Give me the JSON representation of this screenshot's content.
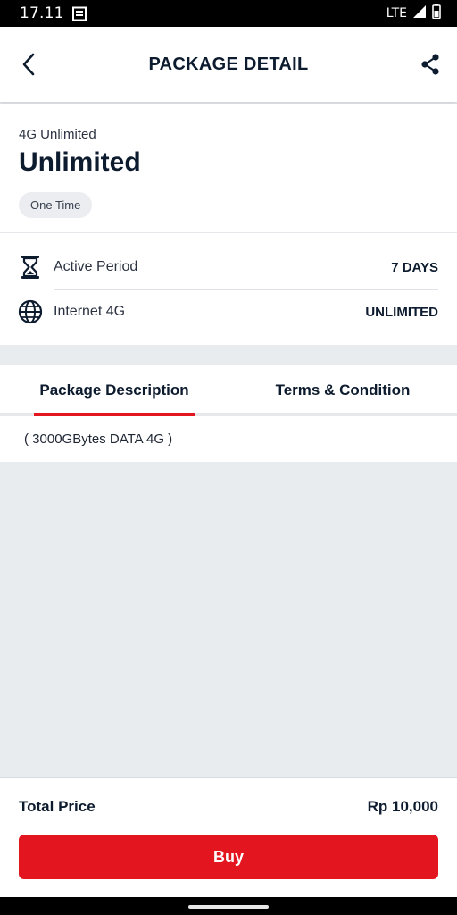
{
  "status_bar": {
    "time": "17.11",
    "network": "LTE",
    "icons": [
      "news-notification-icon",
      "signal-icon",
      "battery-icon"
    ]
  },
  "app_bar": {
    "title": "PACKAGE DETAIL",
    "back_icon": "back-arrow-icon",
    "share_icon": "share-icon"
  },
  "package": {
    "category": "4G Unlimited",
    "name": "Unlimited",
    "badge": "One Time"
  },
  "details": [
    {
      "icon": "hourglass-icon",
      "label": "Active Period",
      "value": "7 DAYS"
    },
    {
      "icon": "globe-icon",
      "label": "Internet 4G",
      "value": "UNLIMITED"
    }
  ],
  "tabs": [
    {
      "label": "Package Description",
      "active": true
    },
    {
      "label": "Terms & Condition",
      "active": false
    }
  ],
  "description": "( 3000GBytes DATA 4G )",
  "footer": {
    "total_label": "Total Price",
    "price": "Rp 10,000",
    "buy_label": "Buy"
  },
  "colors": {
    "accent": "#e3151e",
    "text_primary": "#0d1b2e",
    "background": "#e9ecef"
  }
}
